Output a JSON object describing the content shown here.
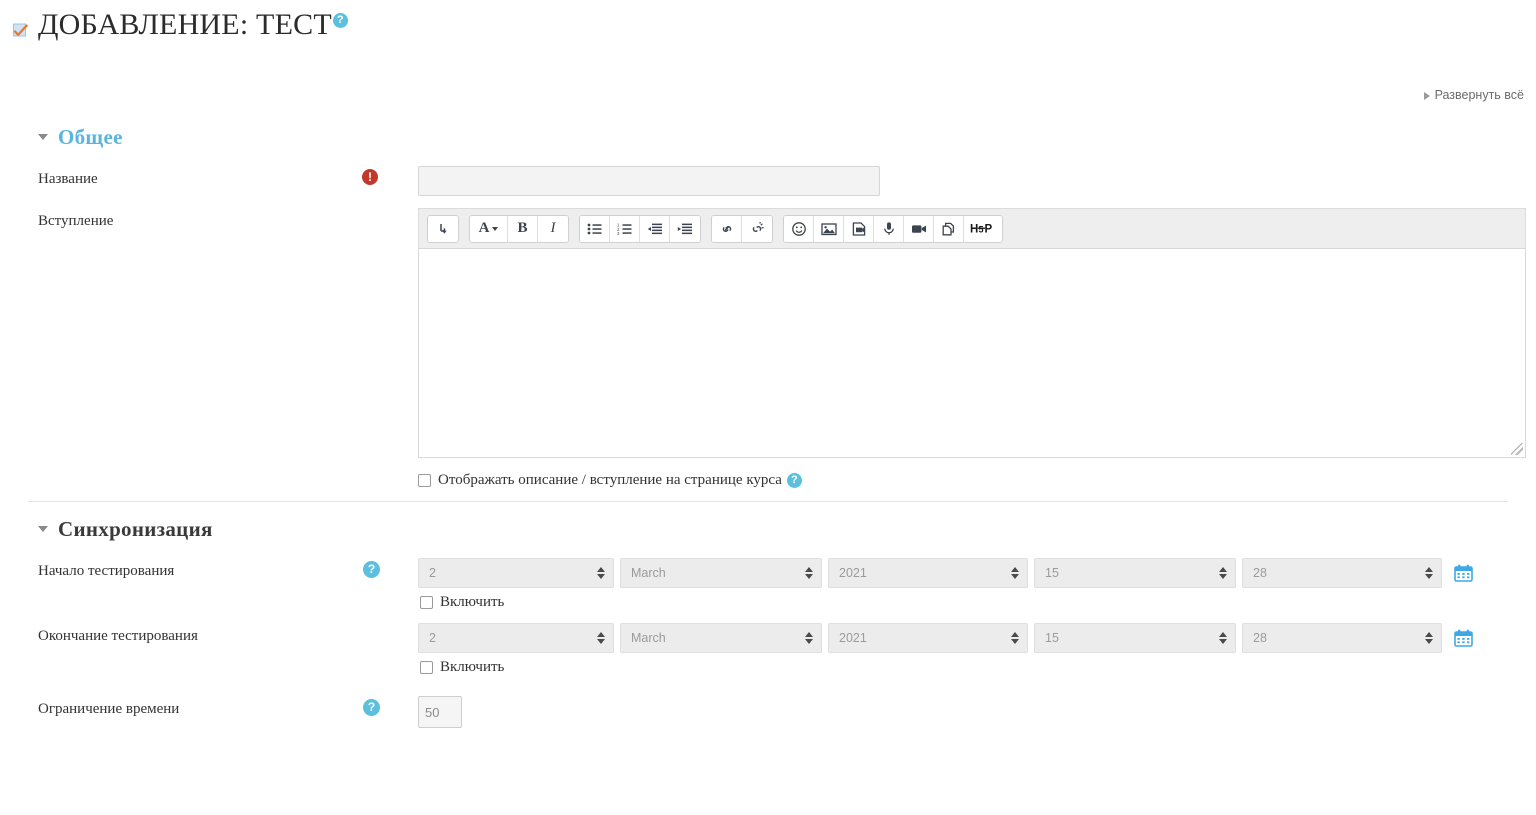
{
  "page": {
    "title": "ДОБАВЛЕНИЕ: ТЕСТ",
    "title_icon": "quiz-icon",
    "title_help": "?",
    "expand_all": "Развернуть всё"
  },
  "colors": {
    "accent_blue": "#5bc0de",
    "section_blue": "#5ab4e0",
    "required_red": "#c0392b",
    "icon_orange": "#e8762c",
    "text_dark": "#333333"
  },
  "sections": [
    {
      "id": "general",
      "label": "Общее",
      "style": "blue",
      "expanded": true
    },
    {
      "id": "timing",
      "label": "Синхронизация",
      "style": "dark",
      "expanded": true
    }
  ],
  "fields": {
    "name": {
      "label": "Название",
      "required_marker": "!",
      "value": "",
      "placeholder": ""
    },
    "intro": {
      "label": "Вступление",
      "value": "",
      "toolbar": [
        {
          "name": "expand-editor-icon",
          "glyph": "⤵"
        },
        {
          "name": "paragraph-style-icon",
          "glyph": "A"
        },
        {
          "name": "bold-icon",
          "glyph": "B"
        },
        {
          "name": "italic-icon",
          "glyph": "I"
        },
        {
          "name": "bullet-list-icon",
          "glyph": "list"
        },
        {
          "name": "numbered-list-icon",
          "glyph": "numlist"
        },
        {
          "name": "outdent-icon",
          "glyph": "outdent"
        },
        {
          "name": "indent-icon",
          "glyph": "indent"
        },
        {
          "name": "link-icon",
          "glyph": "link"
        },
        {
          "name": "unlink-icon",
          "glyph": "unlink"
        },
        {
          "name": "emoji-icon",
          "glyph": "☺"
        },
        {
          "name": "image-icon",
          "glyph": "image"
        },
        {
          "name": "media-icon",
          "glyph": "media"
        },
        {
          "name": "audio-record-icon",
          "glyph": "mic"
        },
        {
          "name": "video-record-icon",
          "glyph": "video"
        },
        {
          "name": "manage-files-icon",
          "glyph": "files"
        },
        {
          "name": "h5p-icon",
          "glyph": "H5P"
        }
      ]
    },
    "show_description": {
      "label": "Отображать описание / вступление на странице курса",
      "checked": false,
      "help": "?"
    },
    "quiz_open": {
      "label": "Начало тестирования",
      "help": "?",
      "enable_label": "Включить",
      "enabled": false,
      "day": "2",
      "month": "March",
      "year": "2021",
      "hour": "15",
      "minute": "28",
      "calendar_icon": "calendar-icon"
    },
    "quiz_close": {
      "label": "Окончание тестирования",
      "help": "?",
      "enable_label": "Включить",
      "enabled": false,
      "day": "2",
      "month": "March",
      "year": "2021",
      "hour": "15",
      "minute": "28",
      "calendar_icon": "calendar-icon"
    },
    "time_limit": {
      "label": "Ограничение времени",
      "help": "?",
      "value": "50"
    }
  }
}
